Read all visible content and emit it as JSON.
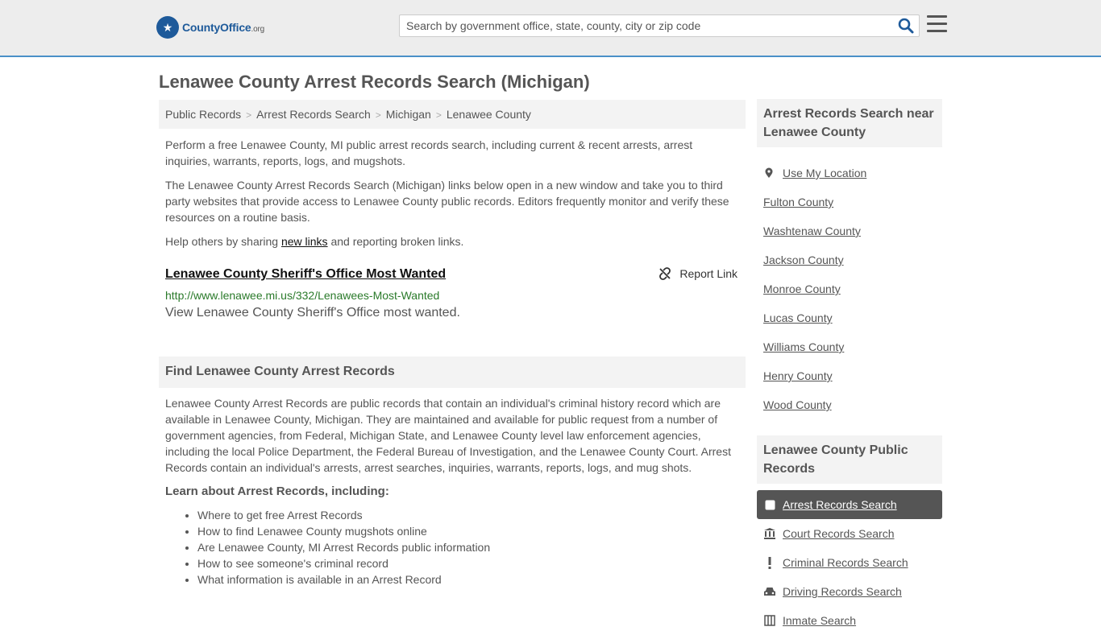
{
  "header": {
    "logo_main": "CountyOffice",
    "logo_suffix": ".org",
    "search_placeholder": "Search by government office, state, county, city or zip code"
  },
  "page": {
    "title": "Lenawee County Arrest Records Search (Michigan)"
  },
  "breadcrumbs": [
    "Public Records",
    "Arrest Records Search",
    "Michigan",
    "Lenawee County"
  ],
  "intro": {
    "p1": "Perform a free Lenawee County, MI public arrest records search, including current & recent arrests, arrest inquiries, warrants, reports, logs, and mugshots.",
    "p2": "The Lenawee County Arrest Records Search (Michigan) links below open in a new window and take you to third party websites that provide access to Lenawee County public records. Editors frequently monitor and verify these resources on a routine basis.",
    "p3_before": "Help others by sharing ",
    "p3_link": "new links",
    "p3_after": " and reporting broken links."
  },
  "result": {
    "title": "Lenawee County Sheriff's Office Most Wanted",
    "url": "http://www.lenawee.mi.us/332/Lenawees-Most-Wanted",
    "description": "View Lenawee County Sheriff's Office most wanted.",
    "report_label": "Report Link"
  },
  "find_section": {
    "heading": "Find Lenawee County Arrest Records",
    "body": "Lenawee County Arrest Records are public records that contain an individual's criminal history record which are available in Lenawee County, Michigan. They are maintained and available for public request from a number of government agencies, from Federal, Michigan State, and Lenawee County level law enforcement agencies, including the local Police Department, the Federal Bureau of Investigation, and the Lenawee County Court. Arrest Records contain an individual's arrests, arrest searches, inquiries, warrants, reports, logs, and mug shots.",
    "learn_title": "Learn about Arrest Records, including:",
    "learn_items": [
      "Where to get free Arrest Records",
      "How to find Lenawee County mugshots online",
      "Are Lenawee County, MI Arrest Records public information",
      "How to see someone's criminal record",
      "What information is available in an Arrest Record"
    ]
  },
  "sidebar": {
    "nearby_heading": "Arrest Records Search near Lenawee County",
    "use_location": "Use My Location",
    "nearby": [
      "Fulton County",
      "Washtenaw County",
      "Jackson County",
      "Monroe County",
      "Lucas County",
      "Williams County",
      "Henry County",
      "Wood County"
    ],
    "records_heading": "Lenawee County Public Records",
    "records": [
      {
        "label": "Arrest Records Search",
        "icon": "square-icon"
      },
      {
        "label": "Court Records Search",
        "icon": "courthouse-icon"
      },
      {
        "label": "Criminal Records Search",
        "icon": "exclamation-icon"
      },
      {
        "label": "Driving Records Search",
        "icon": "car-icon"
      },
      {
        "label": "Inmate Search",
        "icon": "inmate-icon"
      }
    ]
  },
  "colors": {
    "accent": "#4a90c8",
    "logo_blue": "#1e5a9a",
    "url_green": "#2a7a2a",
    "active_bg": "#555555"
  }
}
